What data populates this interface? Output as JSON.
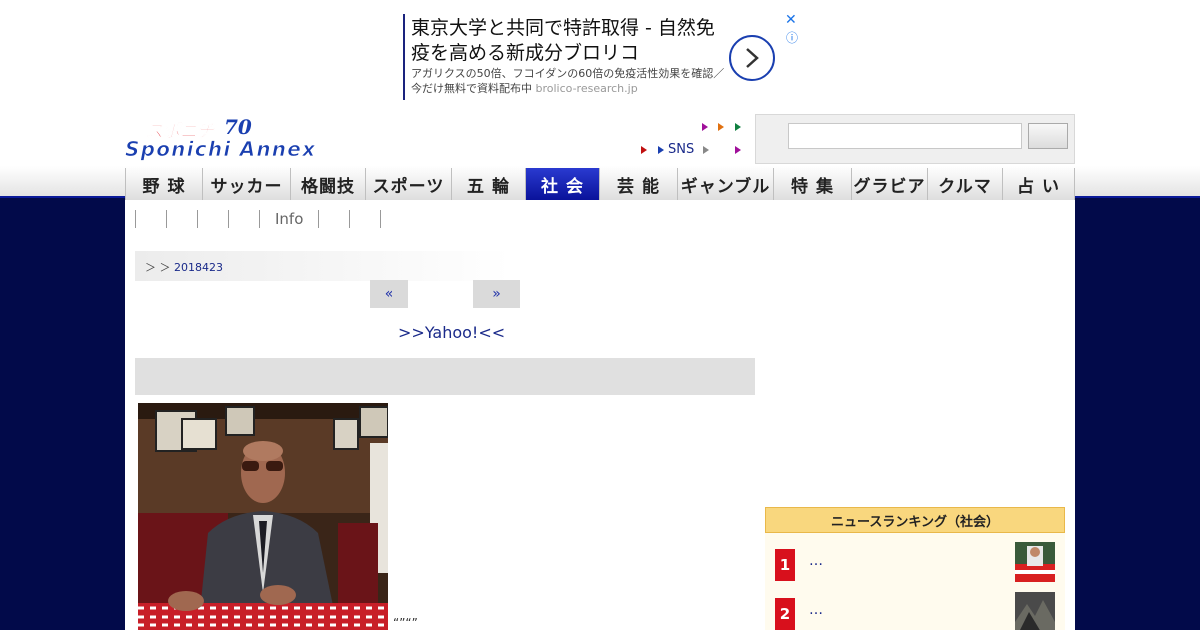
{
  "ad": {
    "title": "東京大学と共同で特許取得 - 自然免疫を高める新成分ブロリコ",
    "description": "アガリクスの50倍、フコイダンの60倍の免疫活性効果を確認／今だけ無料で資料配布中",
    "domain": "brolico-research.jp",
    "close_glyph": "✕",
    "info_glyph": "ⓘ"
  },
  "header": {
    "logo_text": "Sponichi Annex",
    "logo_kana": "スポニチ",
    "logo_number": "70",
    "sns_label": "SNS"
  },
  "nav": {
    "items": [
      {
        "label": "野 球",
        "active": false
      },
      {
        "label": "サッカー",
        "active": false
      },
      {
        "label": "格闘技",
        "active": false
      },
      {
        "label": "スポーツ",
        "active": false
      },
      {
        "label": "五 輪",
        "active": false
      },
      {
        "label": "社 会",
        "active": true
      },
      {
        "label": "芸 能",
        "active": false
      },
      {
        "label": "ギャンブル",
        "active": false
      },
      {
        "label": "特 集",
        "active": false
      },
      {
        "label": "グラビア",
        "active": false
      },
      {
        "label": "クルマ",
        "active": false
      },
      {
        "label": "占 い",
        "active": false
      }
    ]
  },
  "subnav": {
    "info_label": "Info"
  },
  "breadcrumb": {
    "prefix": "＞ ＞",
    "date_link": "2018423"
  },
  "pager": {
    "prev": "«",
    "next": "»"
  },
  "yahoo_link": ">>Yahoo!<<",
  "caption": "“”“”",
  "ranking": {
    "title": "ニュースランキング（社会）",
    "items": [
      {
        "rank": "1",
        "text": "…"
      },
      {
        "rank": "2",
        "text": "…"
      }
    ]
  },
  "colors": {
    "navy_bg": "#020a4a",
    "nav_active": "#0a129a",
    "link": "#1a2a8a",
    "rank_red": "#d8101c",
    "rank_header": "#f9d77e"
  }
}
